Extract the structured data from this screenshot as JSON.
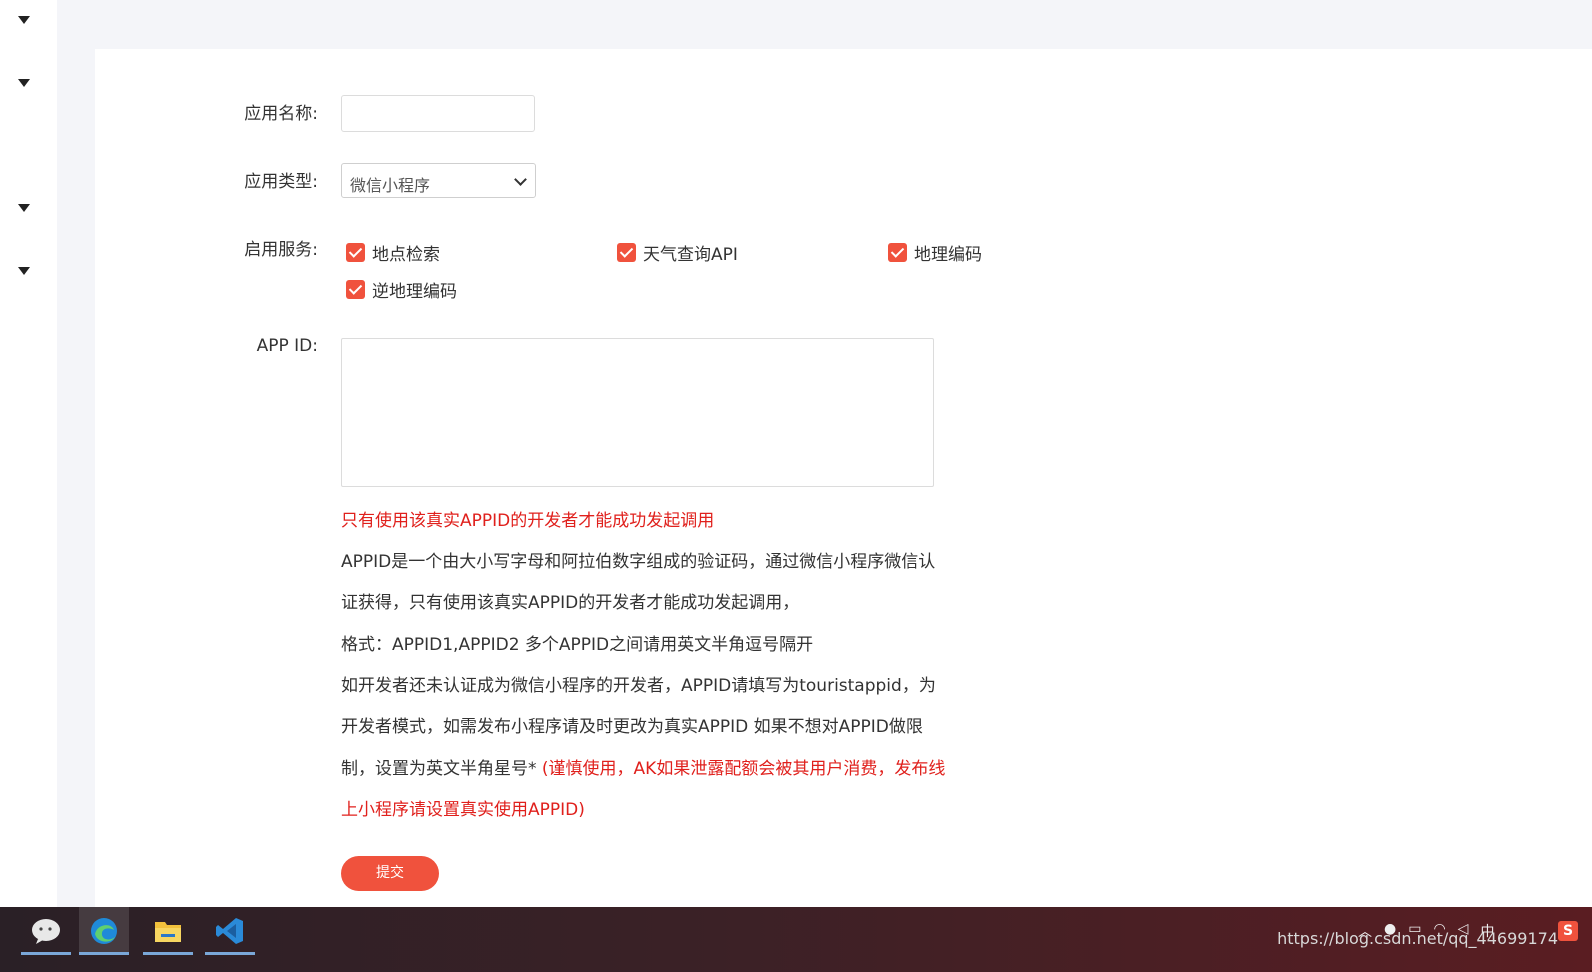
{
  "form": {
    "app_name_label": "应用名称:",
    "app_name_value": "",
    "app_type_label": "应用类型:",
    "app_type_value": "微信小程序",
    "services_label": "启用服务:",
    "services": [
      {
        "label": "地点检索",
        "checked": true
      },
      {
        "label": "天气查询API",
        "checked": true
      },
      {
        "label": "地理编码",
        "checked": true
      },
      {
        "label": "逆地理编码",
        "checked": true
      }
    ],
    "appid_label": "APP ID:",
    "appid_value": "",
    "notes": {
      "warning": "只有使用该真实APPID的开发者才能成功发起调用",
      "line1": "APPID是一个由大小写字母和阿拉伯数字组成的验证码，通过微信小程序微信认",
      "line2": "证获得，只有使用该真实APPID的开发者才能成功发起调用，",
      "line3": "格式：APPID1,APPID2 多个APPID之间请用英文半角逗号隔开",
      "line4": "如开发者还未认证成为微信小程序的开发者，APPID请填写为touristappid，为",
      "line5": "开发者模式，如需发布小程序请及时更改为真实APPID 如果不想对APPID做限",
      "line6_black": "制，设置为英文半角星号* ",
      "line6_red": "(谨慎使用，AK如果泄露配额会被其用户消费，发布线",
      "line7_red": "上小程序请设置真实使用APPID)"
    },
    "submit_label": "提交"
  },
  "taskbar": {
    "apps": [
      "wechat-app-icon",
      "edge-app-icon",
      "file-explorer-app-icon",
      "vscode-app-icon"
    ],
    "tray_ime": "中",
    "watermark": "https://blog.csdn.net/qq_44699174"
  }
}
